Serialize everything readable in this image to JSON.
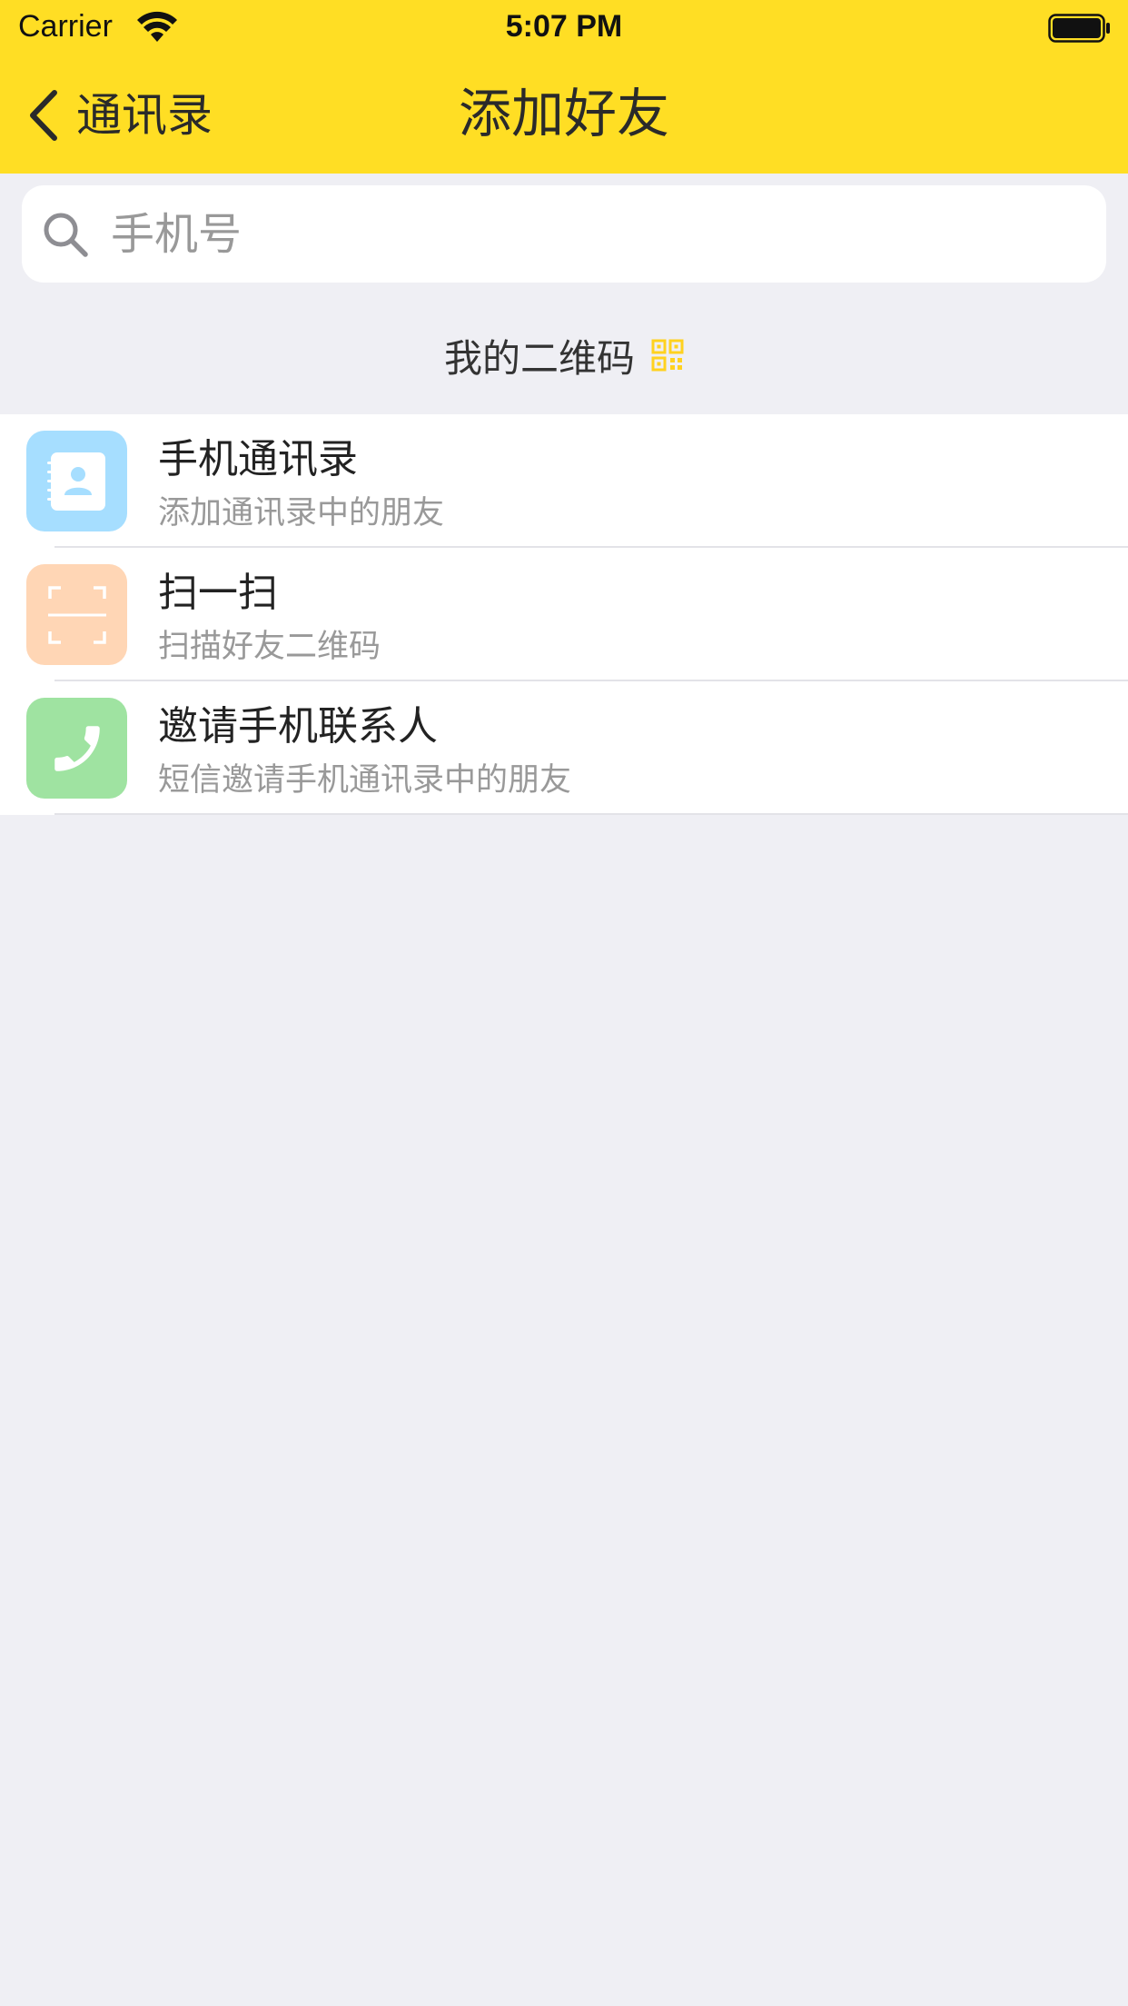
{
  "status_bar": {
    "carrier": "Carrier",
    "time": "5:07 PM"
  },
  "nav": {
    "back_label": "通讯录",
    "title": "添加好友"
  },
  "search": {
    "placeholder": "手机号",
    "value": ""
  },
  "qr": {
    "label": "我的二维码"
  },
  "colors": {
    "header": "#FFDE24",
    "background": "#EFEFF4",
    "contacts_icon_bg": "#A6DEFF",
    "scan_icon_bg": "#FFD6B5",
    "invite_icon_bg": "#9FE3A1"
  },
  "list": {
    "items": [
      {
        "title": "手机通讯录",
        "subtitle": "添加通讯录中的朋友",
        "icon": "contacts-book-icon"
      },
      {
        "title": "扫一扫",
        "subtitle": "扫描好友二维码",
        "icon": "scan-icon"
      },
      {
        "title": "邀请手机联系人",
        "subtitle": "短信邀请手机通讯录中的朋友",
        "icon": "phone-icon"
      }
    ]
  }
}
